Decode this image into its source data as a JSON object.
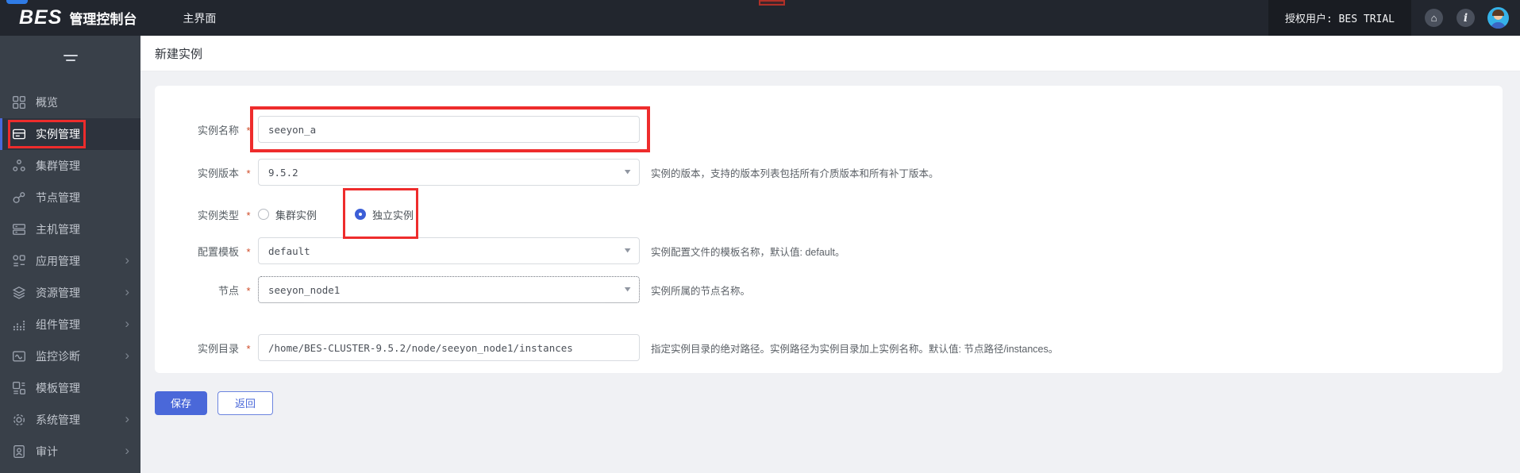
{
  "header": {
    "logo": "BES",
    "logo_title": "管理控制台",
    "nav_tab": "主界面",
    "licensed_user": "授权用户: BES TRIAL"
  },
  "sidebar": {
    "items": [
      {
        "id": "overview",
        "label": "概览",
        "icon": "overview",
        "active": false,
        "has_children": false
      },
      {
        "id": "instance",
        "label": "实例管理",
        "icon": "instance",
        "active": true,
        "has_children": false,
        "annotated": true
      },
      {
        "id": "cluster",
        "label": "集群管理",
        "icon": "cluster",
        "active": false,
        "has_children": false
      },
      {
        "id": "node",
        "label": "节点管理",
        "icon": "node",
        "active": false,
        "has_children": false
      },
      {
        "id": "host",
        "label": "主机管理",
        "icon": "host",
        "active": false,
        "has_children": false
      },
      {
        "id": "app",
        "label": "应用管理",
        "icon": "app",
        "active": false,
        "has_children": true
      },
      {
        "id": "resource",
        "label": "资源管理",
        "icon": "resource",
        "active": false,
        "has_children": true
      },
      {
        "id": "component",
        "label": "组件管理",
        "icon": "component",
        "active": false,
        "has_children": true
      },
      {
        "id": "monitor",
        "label": "监控诊断",
        "icon": "monitor",
        "active": false,
        "has_children": true
      },
      {
        "id": "template",
        "label": "模板管理",
        "icon": "template",
        "active": false,
        "has_children": false
      },
      {
        "id": "system",
        "label": "系统管理",
        "icon": "system",
        "active": false,
        "has_children": true
      },
      {
        "id": "audit",
        "label": "审计",
        "icon": "audit",
        "active": false,
        "has_children": true
      }
    ]
  },
  "page": {
    "title": "新建实例"
  },
  "form": {
    "required_marker": "*",
    "fields": [
      {
        "id": "instance-name",
        "label": "实例名称",
        "required": true,
        "type": "input",
        "value": "seeyon_a",
        "help": "",
        "annotated": true
      },
      {
        "id": "instance-version",
        "label": "实例版本",
        "required": true,
        "type": "select",
        "value": "9.5.2",
        "help": "实例的版本，支持的版本列表包括所有介质版本和所有补丁版本。"
      },
      {
        "id": "instance-type",
        "label": "实例类型",
        "required": true,
        "type": "radio",
        "options": [
          {
            "name": "cluster-instance",
            "label": "集群实例",
            "checked": false
          },
          {
            "name": "standalone-instance",
            "label": "独立实例",
            "checked": true,
            "annotated": true
          }
        ]
      },
      {
        "id": "config-template",
        "label": "配置模板",
        "required": true,
        "type": "select",
        "value": "default",
        "help": "实例配置文件的模板名称，默认值: default。"
      },
      {
        "id": "node",
        "label": "节点",
        "required": true,
        "type": "select",
        "value": "seeyon_node1",
        "help": "实例所属的节点名称。",
        "focused": true
      },
      {
        "id": "instance-dir",
        "label": "实例目录",
        "required": true,
        "type": "input",
        "value": "/home/BES-CLUSTER-9.5.2/node/seeyon_node1/instances",
        "help": "指定实例目录的绝对路径。实例路径为实例目录加上实例名称。默认值: 节点路径/instances。"
      }
    ],
    "buttons": {
      "save": "保存",
      "back": "返回"
    }
  },
  "colors": {
    "header_bg": "#22262e",
    "sidebar_bg": "#394049",
    "primary_blue": "#4a68d9",
    "radio_checked": "#3c5fd7",
    "annotation_red": "#ee2c2c",
    "required_red": "#cf4b28"
  }
}
